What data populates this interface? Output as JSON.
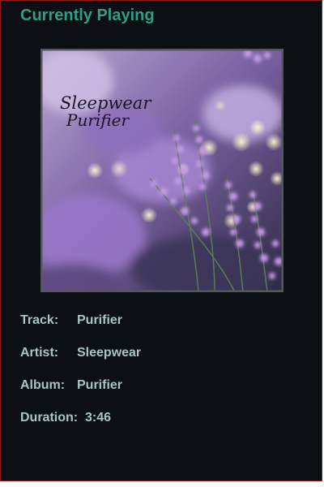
{
  "title": "Currently Playing",
  "album_art": {
    "text_artist": "Sleepwear",
    "text_track": "Purifier"
  },
  "fields": {
    "track": {
      "label": "Track:",
      "value": "Purifier"
    },
    "artist": {
      "label": "Artist:",
      "value": "Sleepwear"
    },
    "album": {
      "label": "Album:",
      "value": "Purifier"
    },
    "duration": {
      "label": "Duration:",
      "value": "3:46"
    }
  }
}
